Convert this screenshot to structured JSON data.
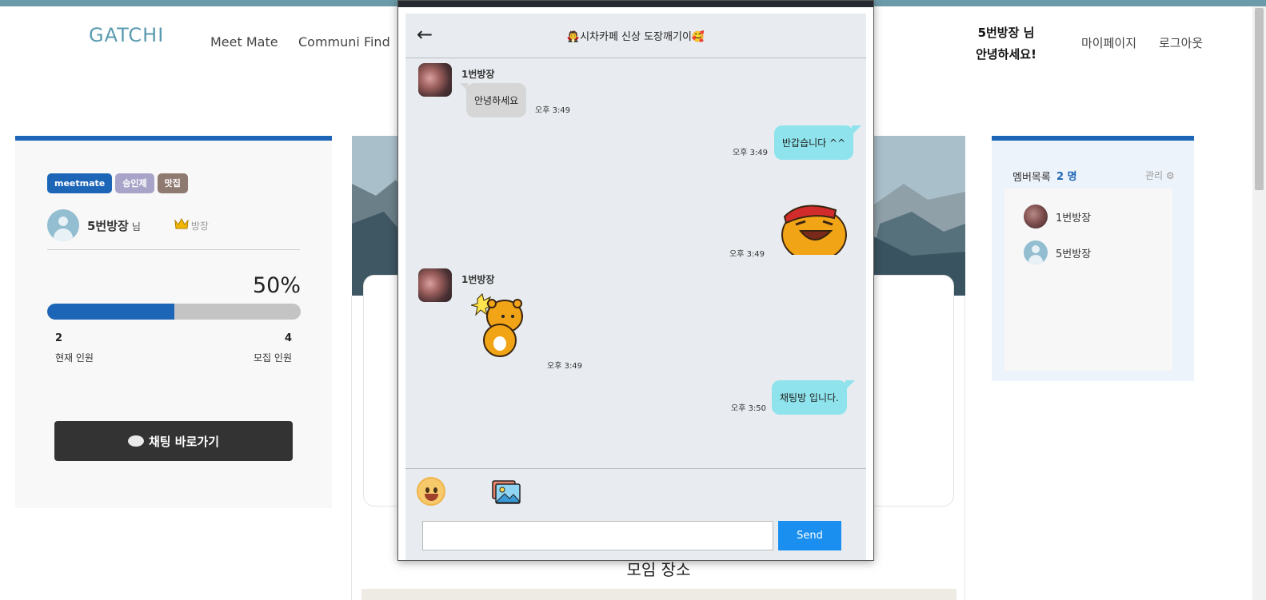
{
  "header": {
    "logo": "GATCHI",
    "nav": [
      "Meet Mate",
      "Communi Find"
    ],
    "greeting_line1": "5번방장 님",
    "greeting_line2": "안녕하세요!",
    "mypage": "마이페이지",
    "logout": "로그아웃"
  },
  "left_card": {
    "tags": [
      "meetmate",
      "승인제",
      "맛집"
    ],
    "host_name": "5번방장",
    "host_suffix": "님",
    "crown_icon": "crown-icon",
    "role_label": "방장",
    "percent_label": "50%",
    "progress_fraction": 0.5,
    "current_count": "2",
    "max_count": "4",
    "current_label": "현재 인원",
    "max_label": "모집 인원",
    "chat_button": "채팅 바로가기"
  },
  "center": {
    "place_title": "모임 장소"
  },
  "right_card": {
    "members_title": "멤버목록",
    "members_count": "2 명",
    "manage_label": "관리",
    "members": [
      "1번방장",
      "5번방장"
    ]
  },
  "chat": {
    "title": "🧛시차카페 신상 도장깨기이🥰",
    "back_icon": "←",
    "messages": [
      {
        "sender": "1번방장",
        "text": "안녕하세요",
        "time": "오후 3:49"
      },
      {
        "text": "반갑습니다 ^^",
        "time": "오후 3:49"
      },
      {
        "sticker": "sticker-laughing-bear",
        "time": "오후 3:49"
      },
      {
        "sender": "1번방장",
        "sticker": "sticker-ryan",
        "time": "오후 3:49"
      },
      {
        "text": "채팅방 입니다.",
        "time": "오후 3:50"
      }
    ],
    "input_value": "",
    "send_label": "Send"
  },
  "colors": {
    "accent_blue": "#1d66b7",
    "send_blue": "#1a8ff0",
    "bubble_out": "#8ee3ec",
    "bubble_in": "#d6d6d6",
    "logo": "#5a9bb0"
  }
}
